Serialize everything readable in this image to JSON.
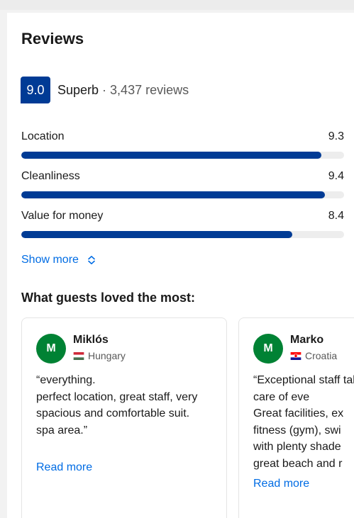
{
  "reviews": {
    "title": "Reviews",
    "score": "9.0",
    "score_word": "Superb",
    "separator": "·",
    "review_count": "3,437 reviews",
    "categories": [
      {
        "label": "Location",
        "score": "9.3",
        "fraction": 0.93
      },
      {
        "label": "Cleanliness",
        "score": "9.4",
        "fraction": 0.94
      },
      {
        "label": "Value for money",
        "score": "8.4",
        "fraction": 0.84
      }
    ],
    "show_more_label": "Show more",
    "loved_title": "What guests loved the most:",
    "cards": [
      {
        "initial": "M",
        "name": "Miklós",
        "country": "Hungary",
        "flag_icon": "hungary-flag-icon",
        "text": "“everything.\nperfect location, great staff, very spacious and comfortable suit.\nspa area.”",
        "read_more": "Read more"
      },
      {
        "initial": "M",
        "name": "Marko",
        "country": "Croatia",
        "flag_icon": "croatia-flag-icon",
        "text": "“Exceptional staff taking care of eve\nGreat facilities, ex\nfitness (gym), swi\nwith plenty shade\ngreat beach and r",
        "read_more": "Read more"
      }
    ]
  },
  "colors": {
    "brand_blue": "#003b95",
    "link_blue": "#006ce4",
    "avatar_green": "#008234",
    "bar_track": "#ededed"
  }
}
